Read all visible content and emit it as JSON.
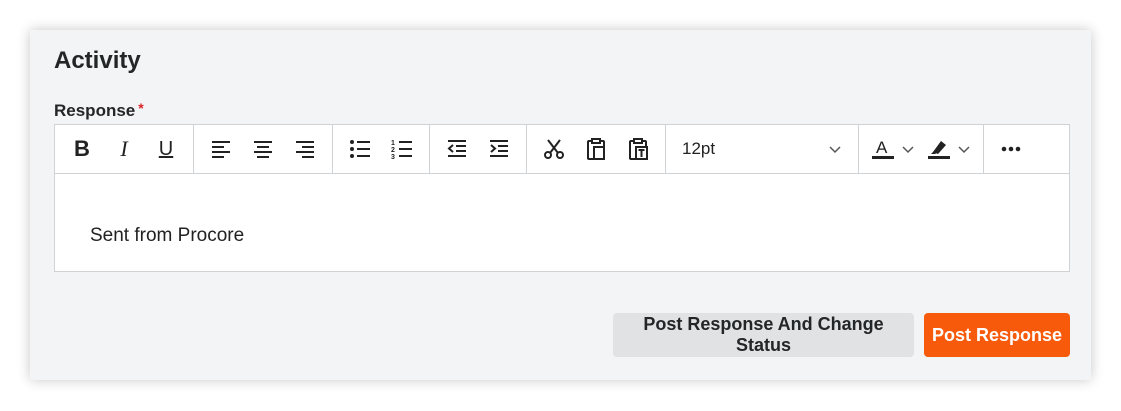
{
  "activity": {
    "title": "Activity",
    "response_label": "Response",
    "required_mark": "*"
  },
  "toolbar": {
    "bold": "B",
    "italic": "I",
    "underline": "U",
    "font_size": "12pt",
    "icons": [
      "bold",
      "italic",
      "underline",
      "align-left",
      "align-center",
      "align-right",
      "bullet-list",
      "numbered-list",
      "outdent",
      "indent",
      "cut",
      "paste",
      "paste-as-text",
      "font-color",
      "highlight-color",
      "more"
    ]
  },
  "editor": {
    "content": "Sent from Procore"
  },
  "actions": {
    "secondary_label": "Post Response And Change Status",
    "primary_label": "Post Response"
  },
  "colors": {
    "primary": "#f65a0a",
    "secondary": "#e0e2e4",
    "required": "#d8242a"
  }
}
